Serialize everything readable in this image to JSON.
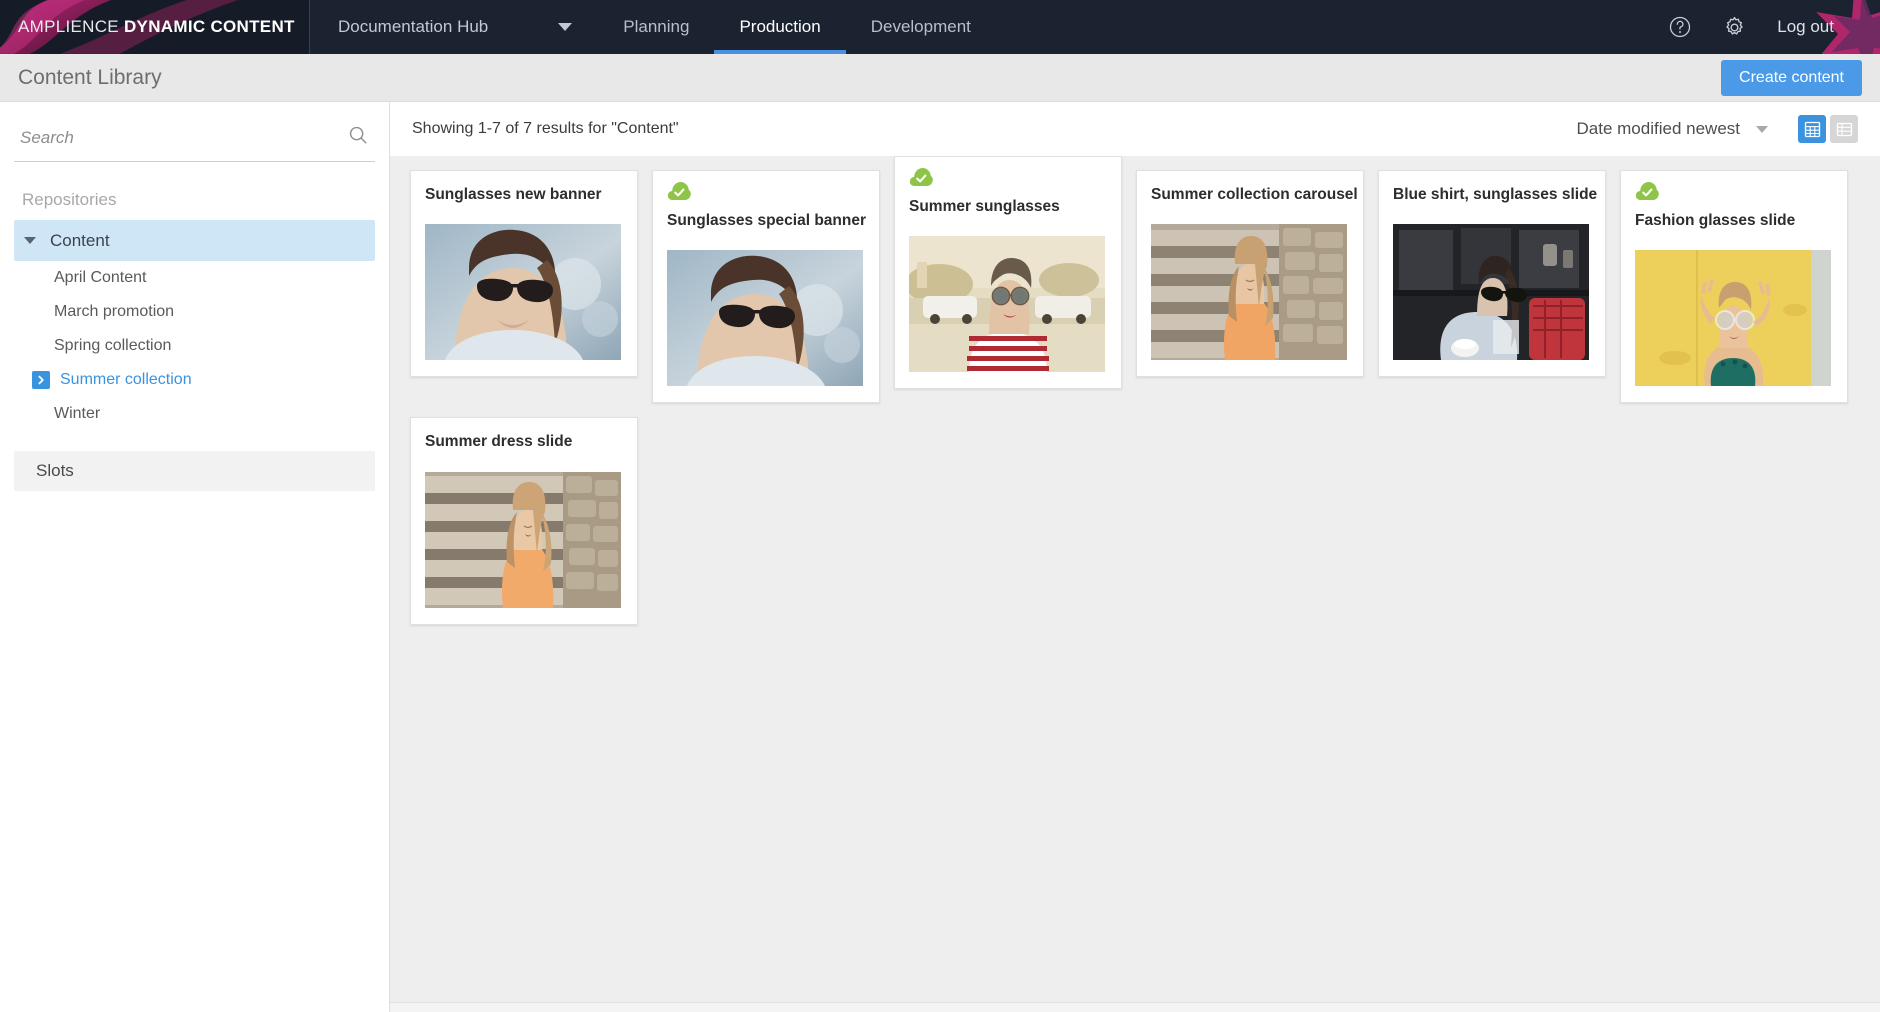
{
  "topbar": {
    "brand_light": "AMPLIENCE ",
    "brand_bold": "DYNAMIC CONTENT",
    "hub_label": "Documentation Hub",
    "tabs": [
      {
        "label": "Planning",
        "active": false
      },
      {
        "label": "Production",
        "active": true
      },
      {
        "label": "Development",
        "active": false
      }
    ],
    "help_icon": "question-circle-icon",
    "settings_icon": "gear-icon",
    "logout_label": "Log out",
    "accent_active": "#4a90e2",
    "bg": "#1b2230"
  },
  "subheader": {
    "title": "Content Library",
    "create_label": "Create content",
    "create_color": "#4a9ae8"
  },
  "sidebar": {
    "search_placeholder": "Search",
    "search_value": "",
    "search_icon": "search-icon",
    "repositories_label": "Repositories",
    "repo": {
      "label": "Content",
      "expanded": true,
      "selected": true
    },
    "tree": [
      {
        "label": "April Content",
        "active": false
      },
      {
        "label": "March promotion",
        "active": false
      },
      {
        "label": "Spring collection",
        "active": false
      },
      {
        "label": "Summer collection",
        "active": true
      },
      {
        "label": "Winter",
        "active": false
      }
    ],
    "slots_label": "Slots",
    "active_color": "#3a93df"
  },
  "results": {
    "summary": "Showing 1-7 of 7 results for \"Content\"",
    "sort_label": "Date modified newest",
    "view_grid_icon": "grid-view-icon",
    "view_list_icon": "list-view-icon",
    "active_view": "grid"
  },
  "cards": [
    {
      "title": "Sunglasses new banner",
      "published": false,
      "image": "woman-sunglasses-marina",
      "shift": false
    },
    {
      "title": "Sunglasses special banner",
      "published": true,
      "image": "woman-sunglasses-marina",
      "shift": false
    },
    {
      "title": "Summer sunglasses",
      "published": true,
      "image": "woman-striped-street",
      "shift": true
    },
    {
      "title": "Summer collection carousel",
      "published": false,
      "image": "woman-orange-steps",
      "shift": false
    },
    {
      "title": "Blue shirt, sunglasses slide",
      "published": false,
      "image": "woman-blue-shirt-cafe",
      "shift": false
    },
    {
      "title": "Fashion glasses slide",
      "published": true,
      "image": "woman-yellow-wall",
      "shift": false
    },
    {
      "title": "Summer dress slide",
      "published": false,
      "image": "woman-orange-steps",
      "shift": false
    }
  ],
  "status_colors": {
    "published": "#8ec549"
  }
}
